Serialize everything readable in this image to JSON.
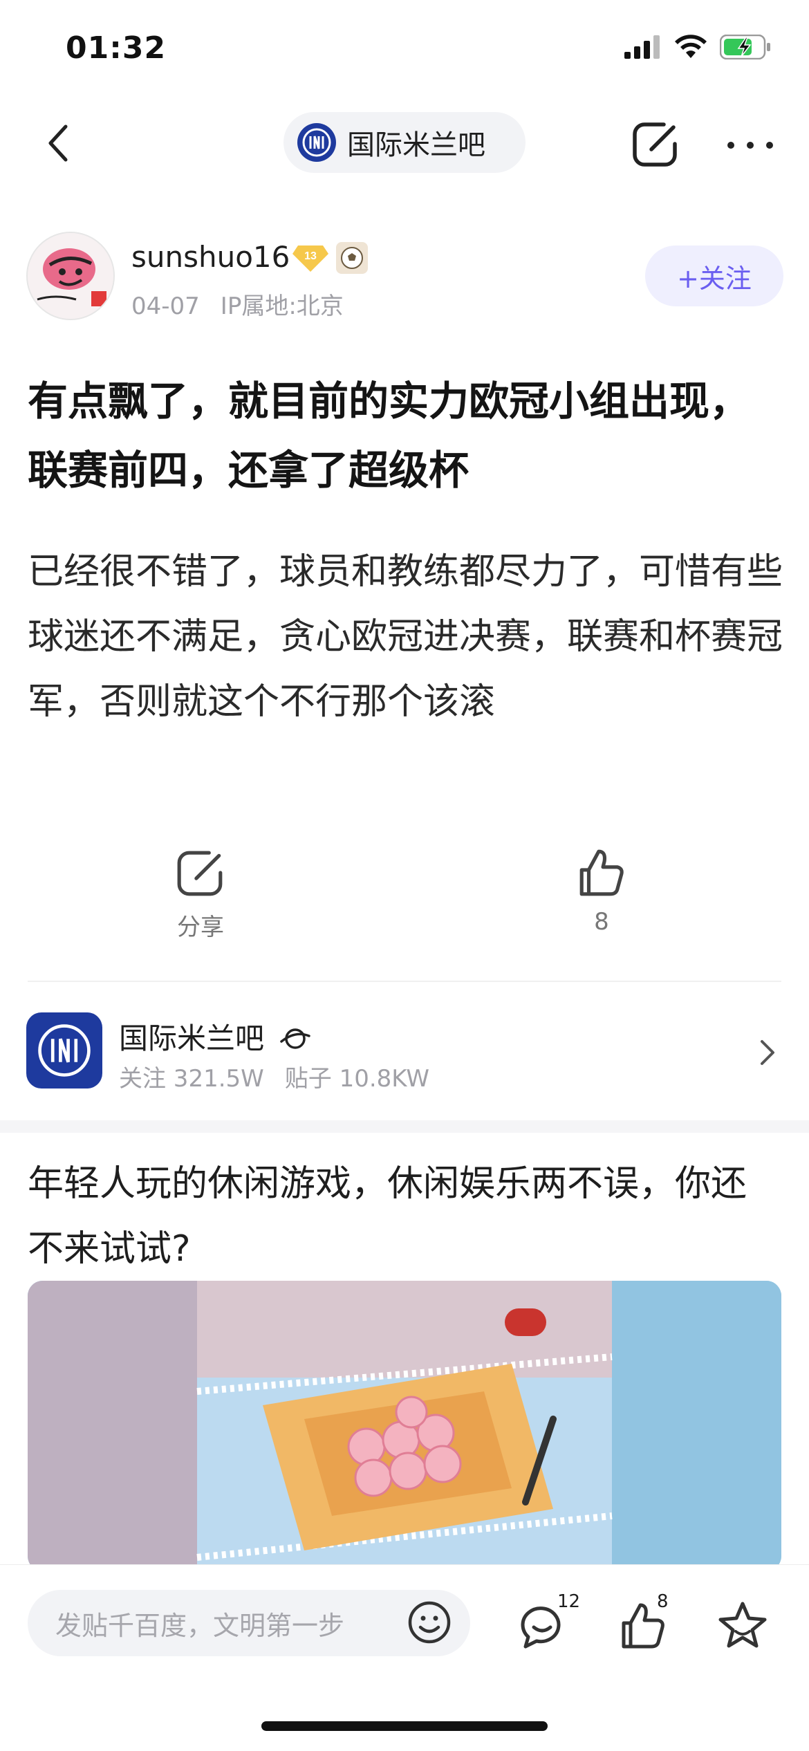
{
  "status_bar": {
    "time": "01:32"
  },
  "nav": {
    "forum_name": "国际米兰吧"
  },
  "author": {
    "username": "sunshuo16",
    "level": "13",
    "date": "04-07",
    "ip_location": "IP属地:北京",
    "follow_label": "+关注"
  },
  "post": {
    "title": "有点飘了，就目前的实力欧冠小组出现，联赛前四，还拿了超级杯",
    "body": "已经很不错了，球员和教练都尽力了，可惜有些球迷还不满足，贪心欧冠进决赛，联赛和杯赛冠军，否则就这个不行那个该滚"
  },
  "actions": {
    "share_label": "分享",
    "like_count": "8"
  },
  "forum_card": {
    "name": "国际米兰吧",
    "followers": "关注 321.5W",
    "posts": "贴子 10.8KW"
  },
  "ad": {
    "title": "年轻人玩的休闲游戏，休闲娱乐两不误，你还不来试试?"
  },
  "bottom_bar": {
    "input_placeholder": "发贴千百度，文明第一步",
    "comment_count": "12",
    "like_count": "8"
  },
  "colors": {
    "accent": "#6a5ef0",
    "inter_blue": "#1e3a9e",
    "battery_green": "#34c759"
  }
}
